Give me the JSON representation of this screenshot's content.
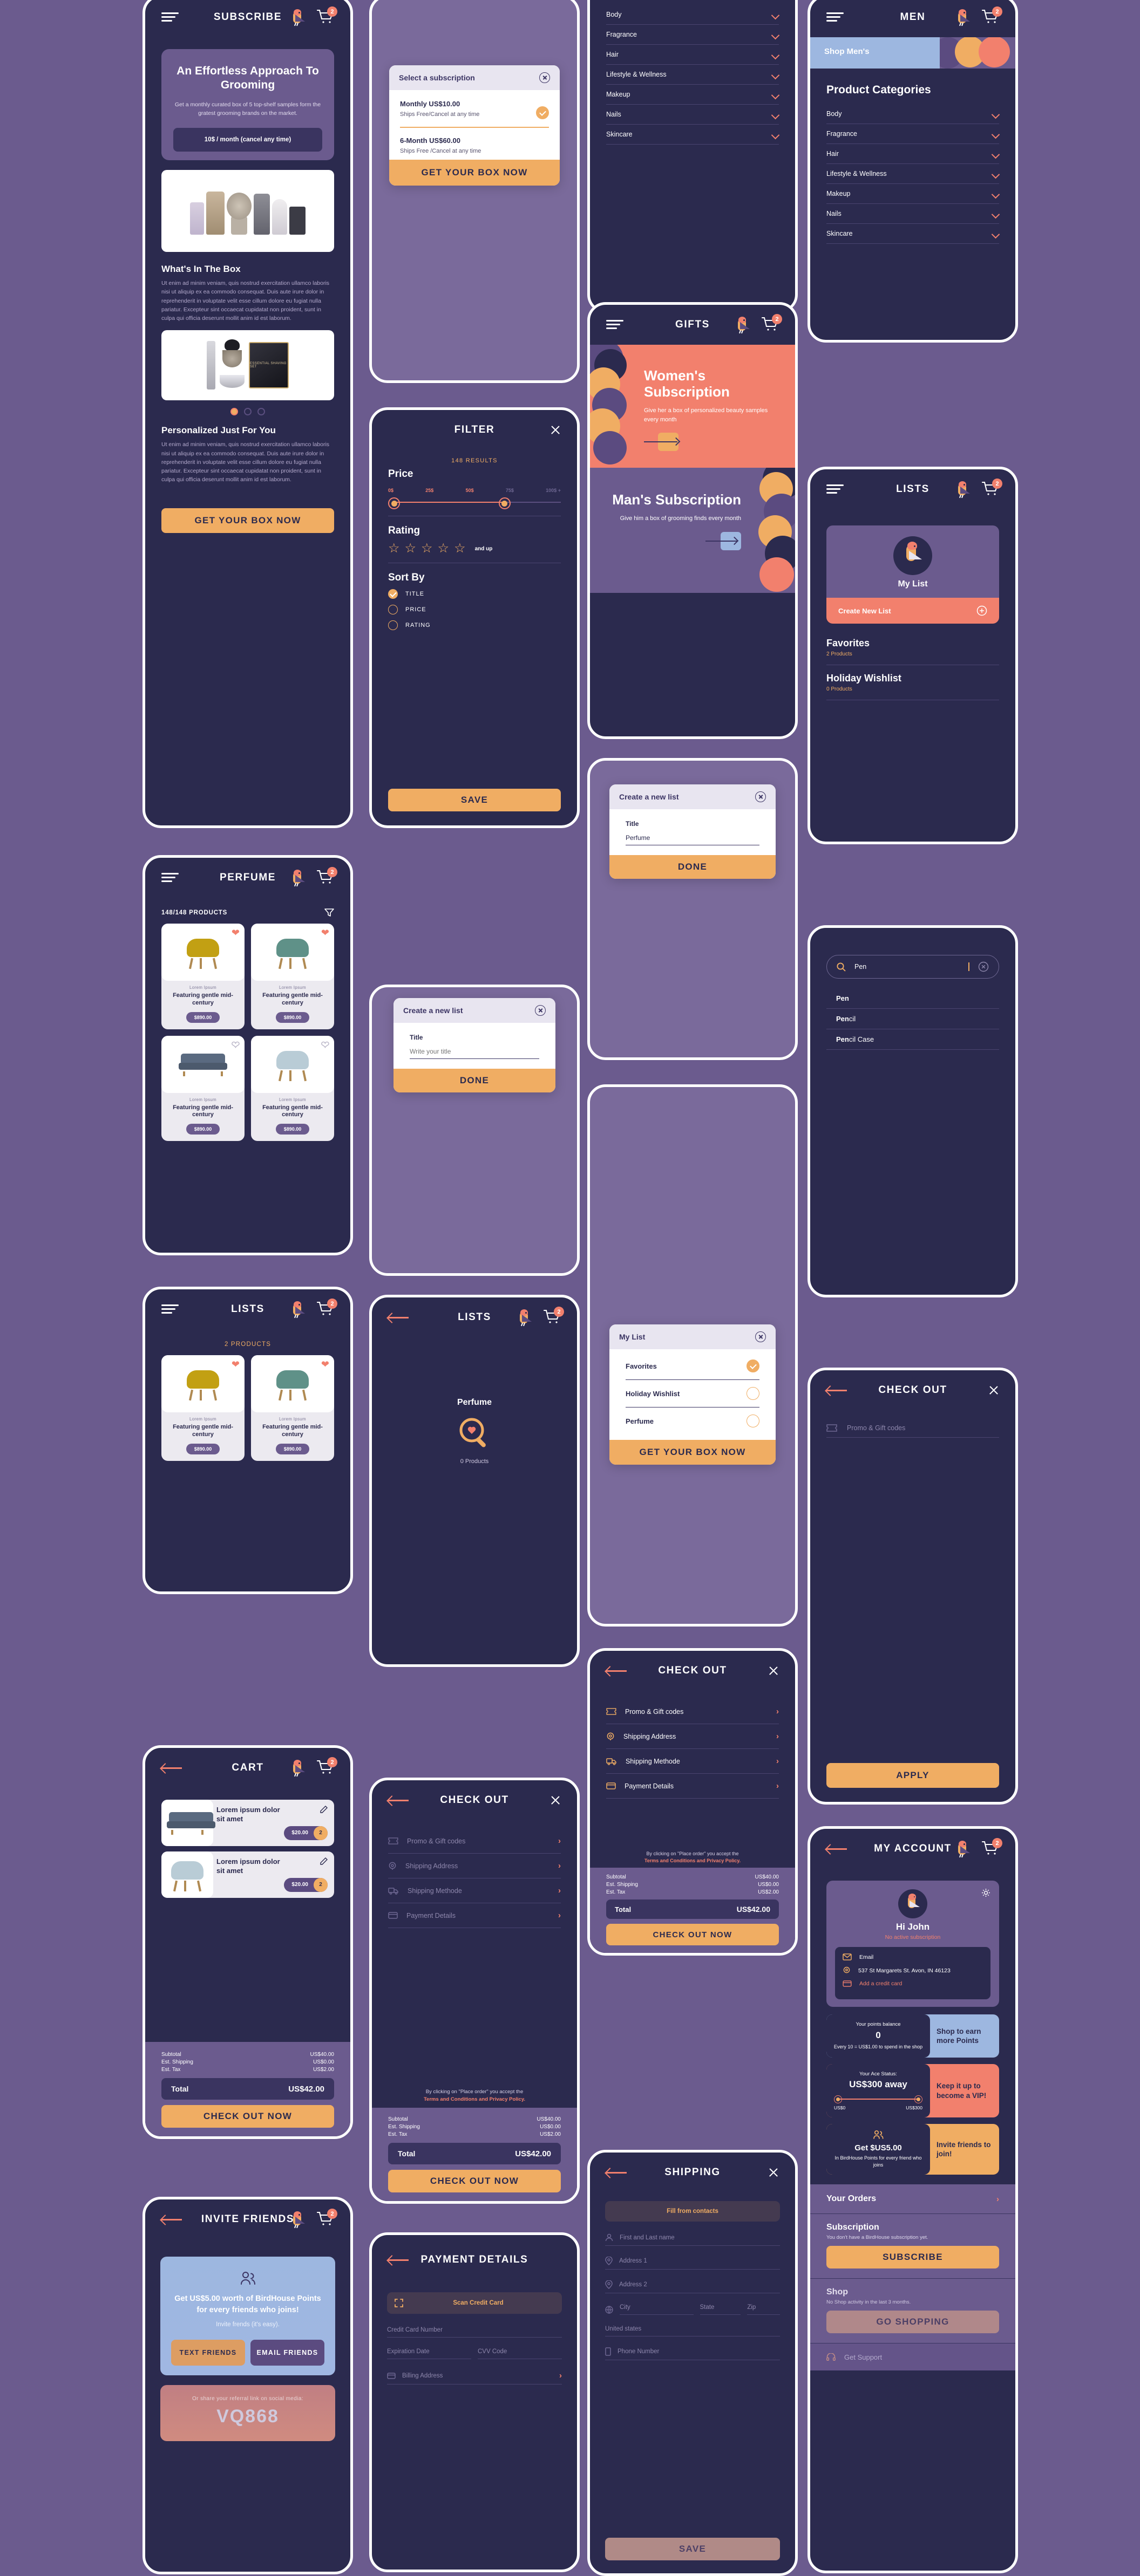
{
  "brand": {
    "name": "BirdHouse",
    "accent_orange": "#f0ad63",
    "accent_coral": "#f2806d",
    "dark": "#2b2a4e",
    "purple": "#6b5b8e",
    "light_blue": "#9db7e0"
  },
  "common": {
    "cart_badge": "2",
    "bird_icon": "bird-logo-icon",
    "cart_icon": "cart-icon",
    "menu_icon": "hamburger-menu-icon",
    "back_icon": "back-arrow-icon",
    "close_icon": "close-icon"
  },
  "subscribe": {
    "title": "SUBSCRIBE",
    "hero_title": "An Effortless Approach To Grooming",
    "hero_sub": "Get a monthly curated box of 5 top-shelf samples form the gratest grooming brands on the market.",
    "price_pill": "10$ / month (cancel any time)",
    "s1_title": "What's In The Box",
    "s1_body": "Ut enim ad minim veniam, quis nostrud exercitation ullamco laboris nisi ut aliquip ex ea commodo consequat. Duis aute irure dolor in reprehenderit in voluptate velit esse cillum dolore eu fugiat nulla pariatur. Excepteur sint occaecat cupidatat non proident, sunt in culpa qui officia deserunt mollit anim id est laborum.",
    "s2_title": "Personalized Just For You",
    "s2_body": "Ut enim ad minim veniam, quis nostrud exercitation ullamco laboris nisi ut aliquip ex ea commodo consequat. Duis aute irure dolor in reprehenderit in voluptate velit esse cillum dolore eu fugiat nulla pariatur. Excepteur sint occaecat cupidatat non proident, sunt in culpa qui officia deserunt mollit anim id est laborum.",
    "cta": "GET YOUR BOX NOW",
    "product_img_caption": "ESSENTIAL SHAVING SET"
  },
  "select_subscription": {
    "title": "Select a subscription",
    "options": [
      {
        "name": "Monthly US$10.00",
        "note": "Ships Free/Cancel at any time",
        "selected": true
      },
      {
        "name": "6-Month US$60.00",
        "note": "Ships Free /Cancel at any time",
        "selected": false
      }
    ],
    "cta": "GET YOUR BOX NOW"
  },
  "filter": {
    "title": "FILTER",
    "results": "148 RESULTS",
    "price_label": "Price",
    "price_ticks": [
      "0$",
      "25$",
      "50$",
      "75$",
      "100$ +"
    ],
    "price_from": 0,
    "price_to": 75,
    "rating_label": "Rating",
    "rating_stars": 5,
    "rating_suffix": "and up",
    "sort_label": "Sort By",
    "sort_options": [
      {
        "label": "TITLE",
        "selected": true
      },
      {
        "label": "PRICE",
        "selected": false
      },
      {
        "label": "RATING",
        "selected": false
      }
    ],
    "save": "SAVE"
  },
  "create_list_modal": {
    "title": "Create a new list",
    "field_label": "Title",
    "placeholder": "Write your title",
    "value": "",
    "done": "DONE"
  },
  "create_list_modal_filled": {
    "title": "Create a new list",
    "field_label": "Title",
    "value": "Perfume",
    "done": "DONE"
  },
  "perfume": {
    "title": "PERFUME",
    "count": "148/148 PRODUCTS",
    "filter_icon": "filter-funnel-icon",
    "products": [
      {
        "brand": "Lorem Ipsum",
        "name": "Featuring gentle mid-century",
        "price": "$890.00",
        "fav": true,
        "kind": "chair",
        "color": "#c2a013"
      },
      {
        "brand": "Lorem Ipsum",
        "name": "Featuring gentle mid-century",
        "price": "$890.00",
        "fav": true,
        "kind": "chair",
        "color": "#5f9188"
      },
      {
        "brand": "Lorem Ipsum",
        "name": "Featuring gentle mid-century",
        "price": "$890.00",
        "fav": false,
        "kind": "sofa",
        "color": "#5a6a80"
      },
      {
        "brand": "Lorem Ipsum",
        "name": "Featuring gentle mid-century",
        "price": "$890.00",
        "fav": false,
        "kind": "chair",
        "color": "#b9ccd6"
      }
    ]
  },
  "lists_products": {
    "title": "LISTS",
    "count": "2 PRODUCTS",
    "products": [
      {
        "brand": "Lorem Ipsum",
        "name": "Featuring gentle mid-century",
        "price": "$890.00",
        "fav": true,
        "kind": "chair",
        "color": "#c2a013"
      },
      {
        "brand": "Lorem Ipsum",
        "name": "Featuring gentle mid-century",
        "price": "$890.00",
        "fav": true,
        "kind": "chair",
        "color": "#5f9188"
      }
    ]
  },
  "cart": {
    "title": "CART",
    "items": [
      {
        "name": "Lorem ipsum dolor sit amet",
        "price": "$20.00",
        "qty": "2",
        "kind": "sofa",
        "edit_icon": "edit-pencil-icon"
      },
      {
        "name": "Lorem ipsum dolor sit amet",
        "price": "$20.00",
        "qty": "2",
        "kind": "chair",
        "edit_icon": "edit-pencil-icon"
      }
    ],
    "summary": [
      {
        "label": "Subtotal",
        "value": "US$40.00"
      },
      {
        "label": "Est. Shipping",
        "value": "US$0.00"
      },
      {
        "label": "Est. Tax",
        "value": "US$2.00"
      }
    ],
    "total_label": "Total",
    "total_value": "US$42.00",
    "cta": "CHECK OUT NOW"
  },
  "invite": {
    "title": "INVITE FRIENDS",
    "headline": "Get US$5.00 worth of BirdHouse Points for every friends who joins!",
    "sub": "Invite frends (it's easy).",
    "btn_text": "TEXT FRIENDS",
    "btn_email": "EMAIL FRIENDS",
    "share_label": "Or share your referral link on social media:",
    "code": "VQ868",
    "people_icon": "people-group-icon"
  },
  "lists_empty": {
    "title": "LISTS",
    "name": "Perfume",
    "count": "0 Products",
    "icon": "magnifier-heart-icon"
  },
  "checkout": {
    "title": "CHECK OUT",
    "rows": [
      {
        "label": "Promo & Gift codes",
        "icon": "ticket-icon"
      },
      {
        "label": "Shipping Address",
        "icon": "map-pin-icon"
      },
      {
        "label": "Shipping Methode",
        "icon": "truck-icon"
      },
      {
        "label": "Payment Details",
        "icon": "credit-card-icon"
      }
    ],
    "terms_pre": "By clicking on \"Place order\" you accept the",
    "terms_link": "Terms and Conditions and Privacy Policy.",
    "summary": [
      {
        "label": "Subtotal",
        "value": "US$40.00"
      },
      {
        "label": "Est. Shipping",
        "value": "US$0.00"
      },
      {
        "label": "Est. Tax",
        "value": "US$2.00"
      }
    ],
    "total_label": "Total",
    "total_value": "US$42.00",
    "cta": "CHECK OUT NOW"
  },
  "checkout_promo": {
    "title": "CHECK OUT",
    "placeholder": "Promo & Gift codes",
    "icon": "ticket-icon",
    "cta": "APPLY"
  },
  "payment_details": {
    "title": "PAYMENT DETAILS",
    "scan": "Scan Credit Card",
    "scan_icon": "scan-frame-icon",
    "fields": [
      {
        "placeholder": "Credit Card Number"
      },
      {
        "placeholder": "Expiration Date"
      },
      {
        "placeholder": "CVV Code"
      },
      {
        "placeholder": "Billing Address",
        "icon": "credit-card-icon",
        "chevron": true
      }
    ]
  },
  "shipping": {
    "title": "SHIPPING",
    "fill_btn": "Fill from contacts",
    "fields": [
      {
        "placeholder": "First and Last name",
        "icon": "person-icon"
      },
      {
        "placeholder": "Address 1",
        "icon": "map-pin-icon"
      },
      {
        "placeholder": "Address 2",
        "icon": "map-pin-icon"
      },
      {
        "placeholder": "City",
        "icon": "globe-icon"
      },
      {
        "placeholder": "State"
      },
      {
        "placeholder": "Zip"
      },
      {
        "placeholder": "United states"
      },
      {
        "placeholder": "Phone Number",
        "icon": "phone-icon"
      }
    ],
    "save": "SAVE"
  },
  "categories_panel": {
    "items": [
      "Body",
      "Fragrance",
      "Hair",
      "Lifestyle & Wellness",
      "Makeup",
      "Nails",
      "Skincare"
    ],
    "chevron_icon": "chevron-down-icon"
  },
  "gifts": {
    "title": "GIFTS",
    "cards": [
      {
        "heading": "Women's Subscription",
        "sub": "Give her a box of personalized beauty samples every month",
        "arrow_icon": "arrow-right-icon"
      },
      {
        "heading": "Man's Subscription",
        "sub": "Give him a box of grooming finds every month",
        "arrow_icon": "arrow-right-icon"
      }
    ]
  },
  "men": {
    "title": "MEN",
    "banner": "Shop Men's",
    "section_title": "Product Categories",
    "categories": [
      "Body",
      "Fragrance",
      "Hair",
      "Lifestyle & Wellness",
      "Makeup",
      "Nails",
      "Skincare"
    ]
  },
  "lists_page": {
    "title": "LISTS",
    "my_list": "My List",
    "create": "Create New List",
    "plus_icon": "plus-circle-icon",
    "lists": [
      {
        "name": "Favorites",
        "count": "2 Products"
      },
      {
        "name": "Holiday Wishlist",
        "count": "0 Products"
      }
    ]
  },
  "my_list_modal": {
    "title": "My List",
    "items": [
      {
        "label": "Favorites",
        "selected": true
      },
      {
        "label": "Holiday Wishlist",
        "selected": false
      },
      {
        "label": "Perfume",
        "selected": false
      }
    ],
    "cta": "GET YOUR BOX NOW"
  },
  "search": {
    "value": "Pen",
    "search_icon": "search-icon",
    "clear_icon": "clear-circle-icon",
    "suggestions": [
      {
        "bold": "Pen",
        "rest": ""
      },
      {
        "bold": "Pen",
        "rest": "cil"
      },
      {
        "bold": "Pen",
        "rest": "cil Case"
      }
    ]
  },
  "account": {
    "title": "MY ACCOUNT",
    "greeting": "Hi John",
    "status": "No active subscription",
    "gear_icon": "gear-icon",
    "rows": [
      {
        "label": "Email",
        "icon": "mail-icon",
        "accent": false
      },
      {
        "label": "537 St Margarets St. Avon, IN 46123",
        "icon": "map-pin-icon",
        "accent": false
      },
      {
        "label": "Add a credit card",
        "icon": "credit-card-icon",
        "accent": true
      }
    ],
    "points": {
      "label": "Your points balance",
      "value": "0",
      "note": "Every 10 = US$1.00 to spend in the shop",
      "cta": "Shop to earn more Points"
    },
    "ace": {
      "label": "Your Ace Status:",
      "value": "US$300 away",
      "min": "US$0",
      "max": "US$300",
      "cta": "Keep it up to become a VIP!"
    },
    "invite": {
      "value": "Get $US5.00",
      "note": "In BirdHouse Points for every friend who joins",
      "cta": "Invite friends to join!",
      "icon": "people-group-icon"
    },
    "orders": "Your Orders",
    "subscription_title": "Subscription",
    "subscription_note": "You don't have a BirdHouse subscription yet.",
    "subscribe_btn": "SUBSCRIBE",
    "shop_title": "Shop",
    "shop_note": "No Shop activity in the last 3 months.",
    "shop_btn": "GO SHOPPING",
    "support": "Get Support",
    "support_icon": "headset-icon"
  }
}
